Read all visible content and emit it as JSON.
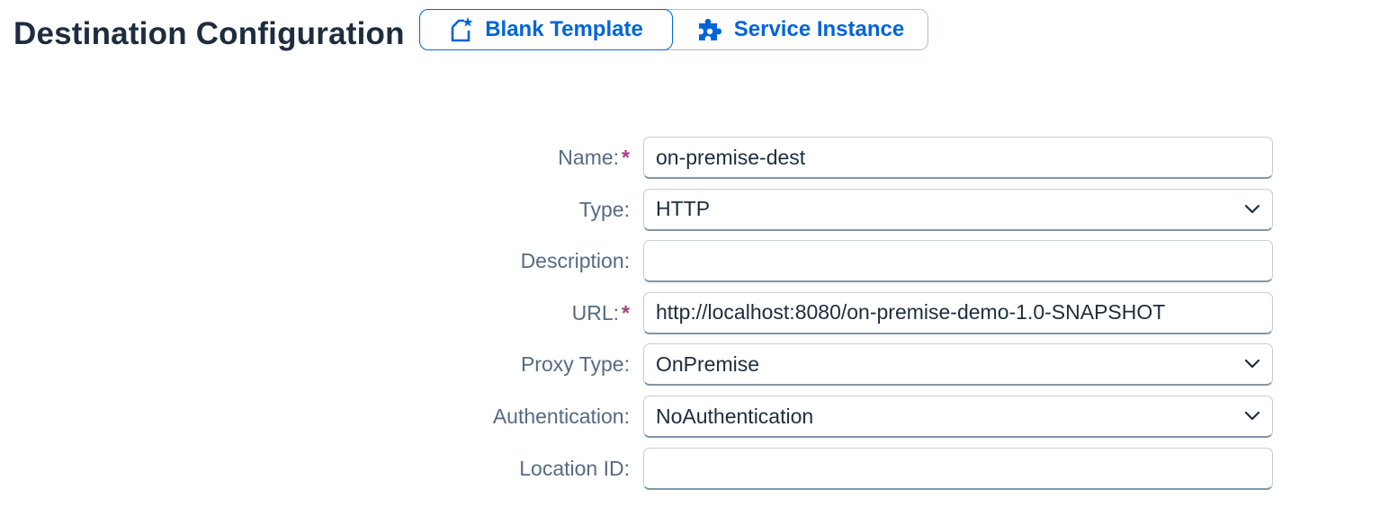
{
  "header": {
    "title": "Destination Configuration",
    "modes": [
      {
        "label": "Blank Template",
        "icon": "new-document-icon",
        "selected": true
      },
      {
        "label": "Service Instance",
        "icon": "puzzle-piece-icon",
        "selected": false
      }
    ]
  },
  "form": {
    "required_marker": "*",
    "fields": [
      {
        "label": "Name:",
        "value": "on-premise-dest",
        "required": true,
        "kind": "input"
      },
      {
        "label": "Type:",
        "value": "HTTP",
        "required": false,
        "kind": "select"
      },
      {
        "label": "Description:",
        "value": "",
        "required": false,
        "kind": "input"
      },
      {
        "label": "URL:",
        "value": "http://localhost:8080/on-premise-demo-1.0-SNAPSHOT",
        "required": true,
        "kind": "input"
      },
      {
        "label": "Proxy Type:",
        "value": "OnPremise",
        "required": false,
        "kind": "select"
      },
      {
        "label": "Authentication:",
        "value": "NoAuthentication",
        "required": false,
        "kind": "select"
      },
      {
        "label": "Location ID:",
        "value": "",
        "required": false,
        "kind": "input"
      }
    ]
  },
  "colors": {
    "accent": "#0064d9",
    "required": "#a93e7d",
    "label": "#556b82",
    "text": "#1d2d3e"
  }
}
